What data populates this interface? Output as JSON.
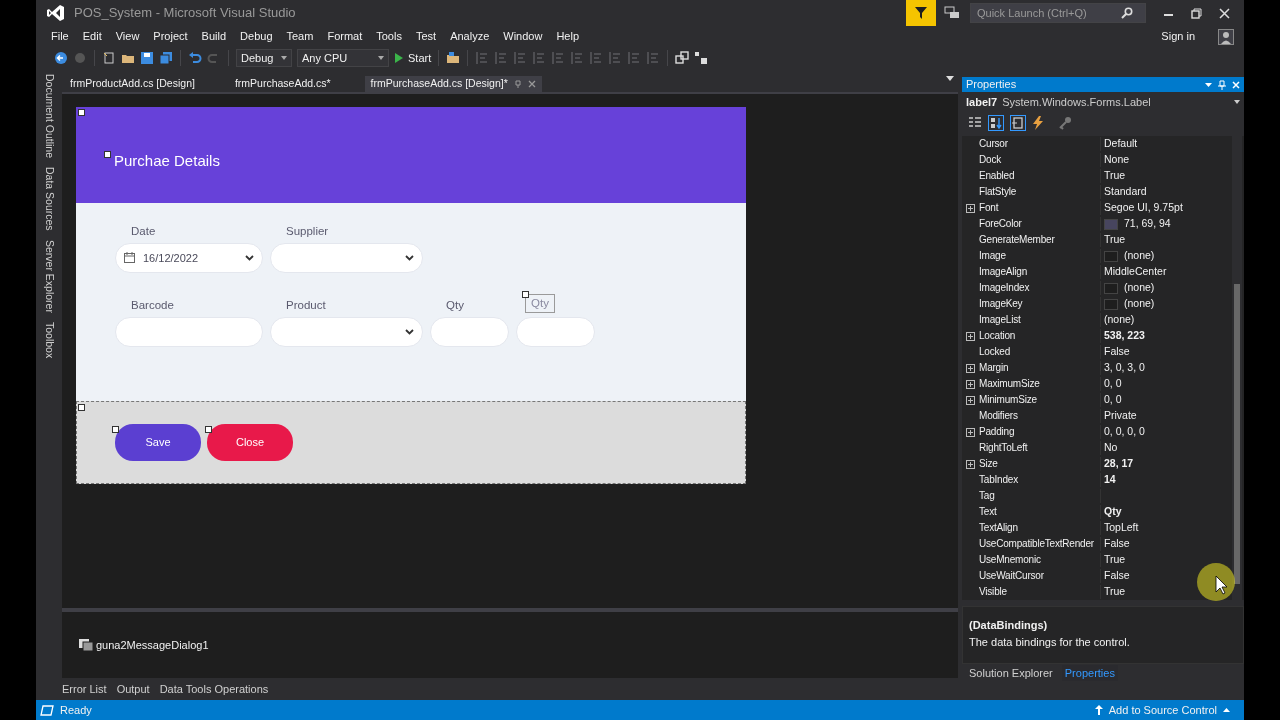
{
  "window": {
    "title": "POS_System - Microsoft Visual Studio"
  },
  "quick_launch": {
    "placeholder": "Quick Launch (Ctrl+Q)"
  },
  "menu": [
    "File",
    "Edit",
    "View",
    "Project",
    "Build",
    "Debug",
    "Team",
    "Format",
    "Tools",
    "Test",
    "Analyze",
    "Window",
    "Help"
  ],
  "account": {
    "sign_in": "Sign in"
  },
  "toolbar": {
    "configuration": "Debug",
    "platform": "Any CPU",
    "start": "Start"
  },
  "side_tabs": [
    "Document Outline",
    "Data Sources",
    "Server Explorer",
    "Toolbox"
  ],
  "document_tabs": [
    {
      "label": "frmProductAdd.cs [Design]",
      "selected": false
    },
    {
      "label": "frmPurchaseAdd.cs*",
      "selected": false
    },
    {
      "label": "frmPurchaseAdd.cs [Design]*",
      "selected": true
    }
  ],
  "form": {
    "title": "Purchae Details",
    "rows": [
      [
        {
          "label": "Date",
          "kind": "date",
          "value": "16/12/2022",
          "selected": false
        },
        {
          "label": "Supplier",
          "kind": "dropdown",
          "selected": false
        }
      ],
      [
        {
          "label": "Barcode",
          "kind": "text",
          "selected": false
        },
        {
          "label": "Product",
          "kind": "dropdown",
          "selected": false
        },
        {
          "label": "Qty",
          "kind": "short",
          "selected": false
        },
        {
          "label": "Qty",
          "kind": "short",
          "selected": true
        }
      ]
    ],
    "buttons": [
      {
        "label": "Save",
        "color": "#5b3fd1"
      },
      {
        "label": "Close",
        "color": "#e8194a"
      }
    ]
  },
  "component_tray": [
    "guna2MessageDialog1"
  ],
  "bottom_tabs": [
    "Error List",
    "Output",
    "Data Tools Operations"
  ],
  "properties": {
    "title": "Properties",
    "object": "label7",
    "object_type": "System.Windows.Forms.Label",
    "rows": [
      {
        "name": "Cursor",
        "value": "Default",
        "expandable": false,
        "modified": false,
        "kind": "plain"
      },
      {
        "name": "Dock",
        "value": "None",
        "expandable": false,
        "modified": false,
        "kind": "plain"
      },
      {
        "name": "Enabled",
        "value": "True",
        "expandable": false,
        "modified": false,
        "kind": "plain"
      },
      {
        "name": "FlatStyle",
        "value": "Standard",
        "expandable": false,
        "modified": false,
        "kind": "plain"
      },
      {
        "name": "Font",
        "value": "Segoe UI, 9.75pt",
        "expandable": true,
        "modified": false,
        "kind": "plain"
      },
      {
        "name": "ForeColor",
        "value": "71, 69, 94",
        "expandable": false,
        "modified": false,
        "kind": "color",
        "color": "#47455e"
      },
      {
        "name": "GenerateMember",
        "value": "True",
        "expandable": false,
        "modified": false,
        "kind": "plain"
      },
      {
        "name": "Image",
        "value": "(none)",
        "expandable": false,
        "modified": false,
        "kind": "image"
      },
      {
        "name": "ImageAlign",
        "value": "MiddleCenter",
        "expandable": false,
        "modified": false,
        "kind": "plain"
      },
      {
        "name": "ImageIndex",
        "value": "(none)",
        "expandable": false,
        "modified": false,
        "kind": "image"
      },
      {
        "name": "ImageKey",
        "value": "(none)",
        "expandable": false,
        "modified": false,
        "kind": "image"
      },
      {
        "name": "ImageList",
        "value": "(none)",
        "expandable": false,
        "modified": false,
        "kind": "plain"
      },
      {
        "name": "Location",
        "value": "538, 223",
        "expandable": true,
        "modified": true,
        "kind": "plain"
      },
      {
        "name": "Locked",
        "value": "False",
        "expandable": false,
        "modified": false,
        "kind": "plain"
      },
      {
        "name": "Margin",
        "value": "3, 0, 3, 0",
        "expandable": true,
        "modified": false,
        "kind": "plain"
      },
      {
        "name": "MaximumSize",
        "value": "0, 0",
        "expandable": true,
        "modified": false,
        "kind": "plain"
      },
      {
        "name": "MinimumSize",
        "value": "0, 0",
        "expandable": true,
        "modified": false,
        "kind": "plain"
      },
      {
        "name": "Modifiers",
        "value": "Private",
        "expandable": false,
        "modified": false,
        "kind": "plain"
      },
      {
        "name": "Padding",
        "value": "0, 0, 0, 0",
        "expandable": true,
        "modified": false,
        "kind": "plain"
      },
      {
        "name": "RightToLeft",
        "value": "No",
        "expandable": false,
        "modified": false,
        "kind": "plain"
      },
      {
        "name": "Size",
        "value": "28, 17",
        "expandable": true,
        "modified": true,
        "kind": "plain"
      },
      {
        "name": "TabIndex",
        "value": "14",
        "expandable": false,
        "modified": true,
        "kind": "plain"
      },
      {
        "name": "Tag",
        "expandable": false,
        "kind": "plain"
      },
      {
        "name": "Text",
        "value": "Qty",
        "expandable": false,
        "modified": true,
        "kind": "plain"
      },
      {
        "name": "TextAlign",
        "value": "TopLeft",
        "expandable": false,
        "modified": false,
        "kind": "plain"
      },
      {
        "name": "UseCompatibleTextRender",
        "value": "False",
        "expandable": false,
        "modified": false,
        "kind": "plain"
      },
      {
        "name": "UseMnemonic",
        "value": "True",
        "expandable": false,
        "modified": false,
        "kind": "plain"
      },
      {
        "name": "UseWaitCursor",
        "value": "False",
        "expandable": false,
        "modified": false,
        "kind": "plain"
      },
      {
        "name": "Visible",
        "value": "True",
        "expandable": false,
        "modified": false,
        "kind": "plain"
      }
    ],
    "description": {
      "title": "(DataBindings)",
      "text": "The data bindings for the control."
    }
  },
  "panel_tabs": [
    {
      "label": "Solution Explorer",
      "selected": false
    },
    {
      "label": "Properties",
      "selected": true
    }
  ],
  "status_bar": {
    "text": "Ready",
    "source_control": "Add to Source Control"
  }
}
